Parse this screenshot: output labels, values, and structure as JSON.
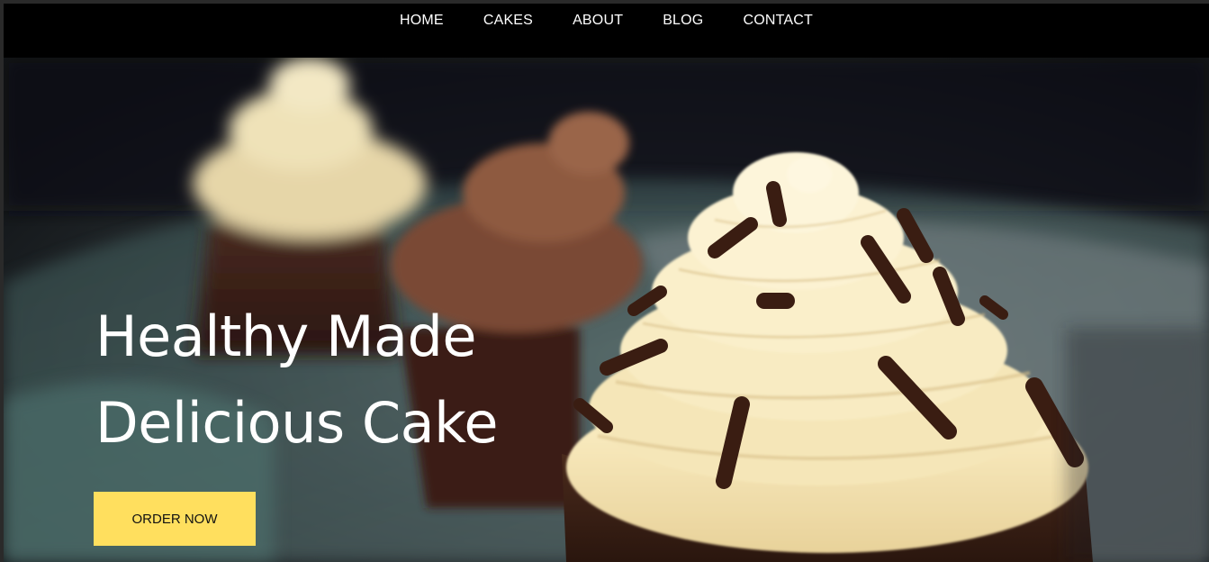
{
  "nav": {
    "items": [
      {
        "label": "HOME"
      },
      {
        "label": "CAKES"
      },
      {
        "label": "ABOUT"
      },
      {
        "label": "BLOG"
      },
      {
        "label": "CONTACT"
      }
    ]
  },
  "hero": {
    "headline_line1": "Healthy Made",
    "headline_line2": "Delicious Cake",
    "cta_label": "ORDER NOW",
    "image_subject": "chocolate cupcakes with vanilla frosting and chocolate sprinkles"
  },
  "colors": {
    "nav_background": "#000000",
    "nav_text": "#ffffff",
    "cta_background": "#ffdf5e",
    "headline_text": "#ffffff"
  }
}
